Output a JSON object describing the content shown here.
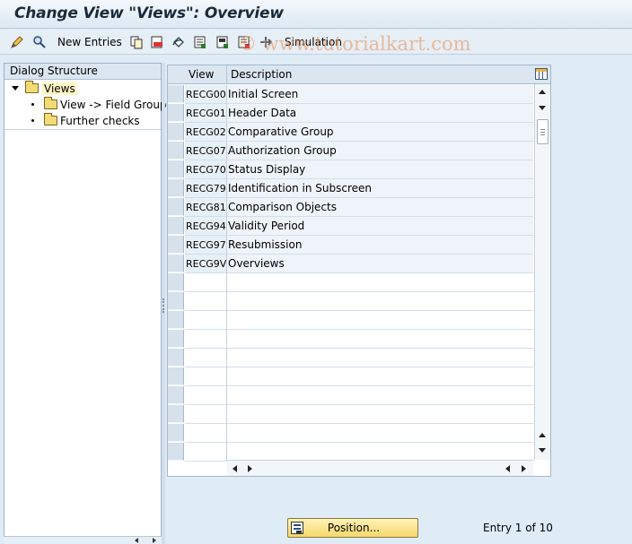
{
  "title": "Change View \"Views\": Overview",
  "toolbar": {
    "new_entries": "New Entries",
    "simulation": "Simulation"
  },
  "watermark": "© www.tutorialkart.com",
  "dialog_structure": {
    "header": "Dialog Structure",
    "items": [
      {
        "label": "Views",
        "selected": true
      },
      {
        "label": "View -> Field Groups"
      },
      {
        "label": "Further checks"
      }
    ]
  },
  "table": {
    "columns": [
      "View",
      "Description"
    ],
    "rows": [
      {
        "view": "RECG00",
        "desc": "Initial Screen"
      },
      {
        "view": "RECG01",
        "desc": "Header Data"
      },
      {
        "view": "RECG02",
        "desc": "Comparative Group"
      },
      {
        "view": "RECG07",
        "desc": "Authorization Group"
      },
      {
        "view": "RECG70",
        "desc": "Status Display"
      },
      {
        "view": "RECG79",
        "desc": "Identification in Subscreen"
      },
      {
        "view": "RECG81",
        "desc": "Comparison Objects"
      },
      {
        "view": "RECG94",
        "desc": "Validity Period"
      },
      {
        "view": "RECG97",
        "desc": "Resubmission"
      },
      {
        "view": "RECG9V",
        "desc": "Overviews"
      }
    ],
    "empty_rows": 10
  },
  "footer": {
    "position_button": "Position...",
    "entry_text": "Entry 1 of 10"
  },
  "colors": {
    "accent": "#f6d86b",
    "selected_tree": "#fff6c6",
    "background": "#dfebf5"
  }
}
